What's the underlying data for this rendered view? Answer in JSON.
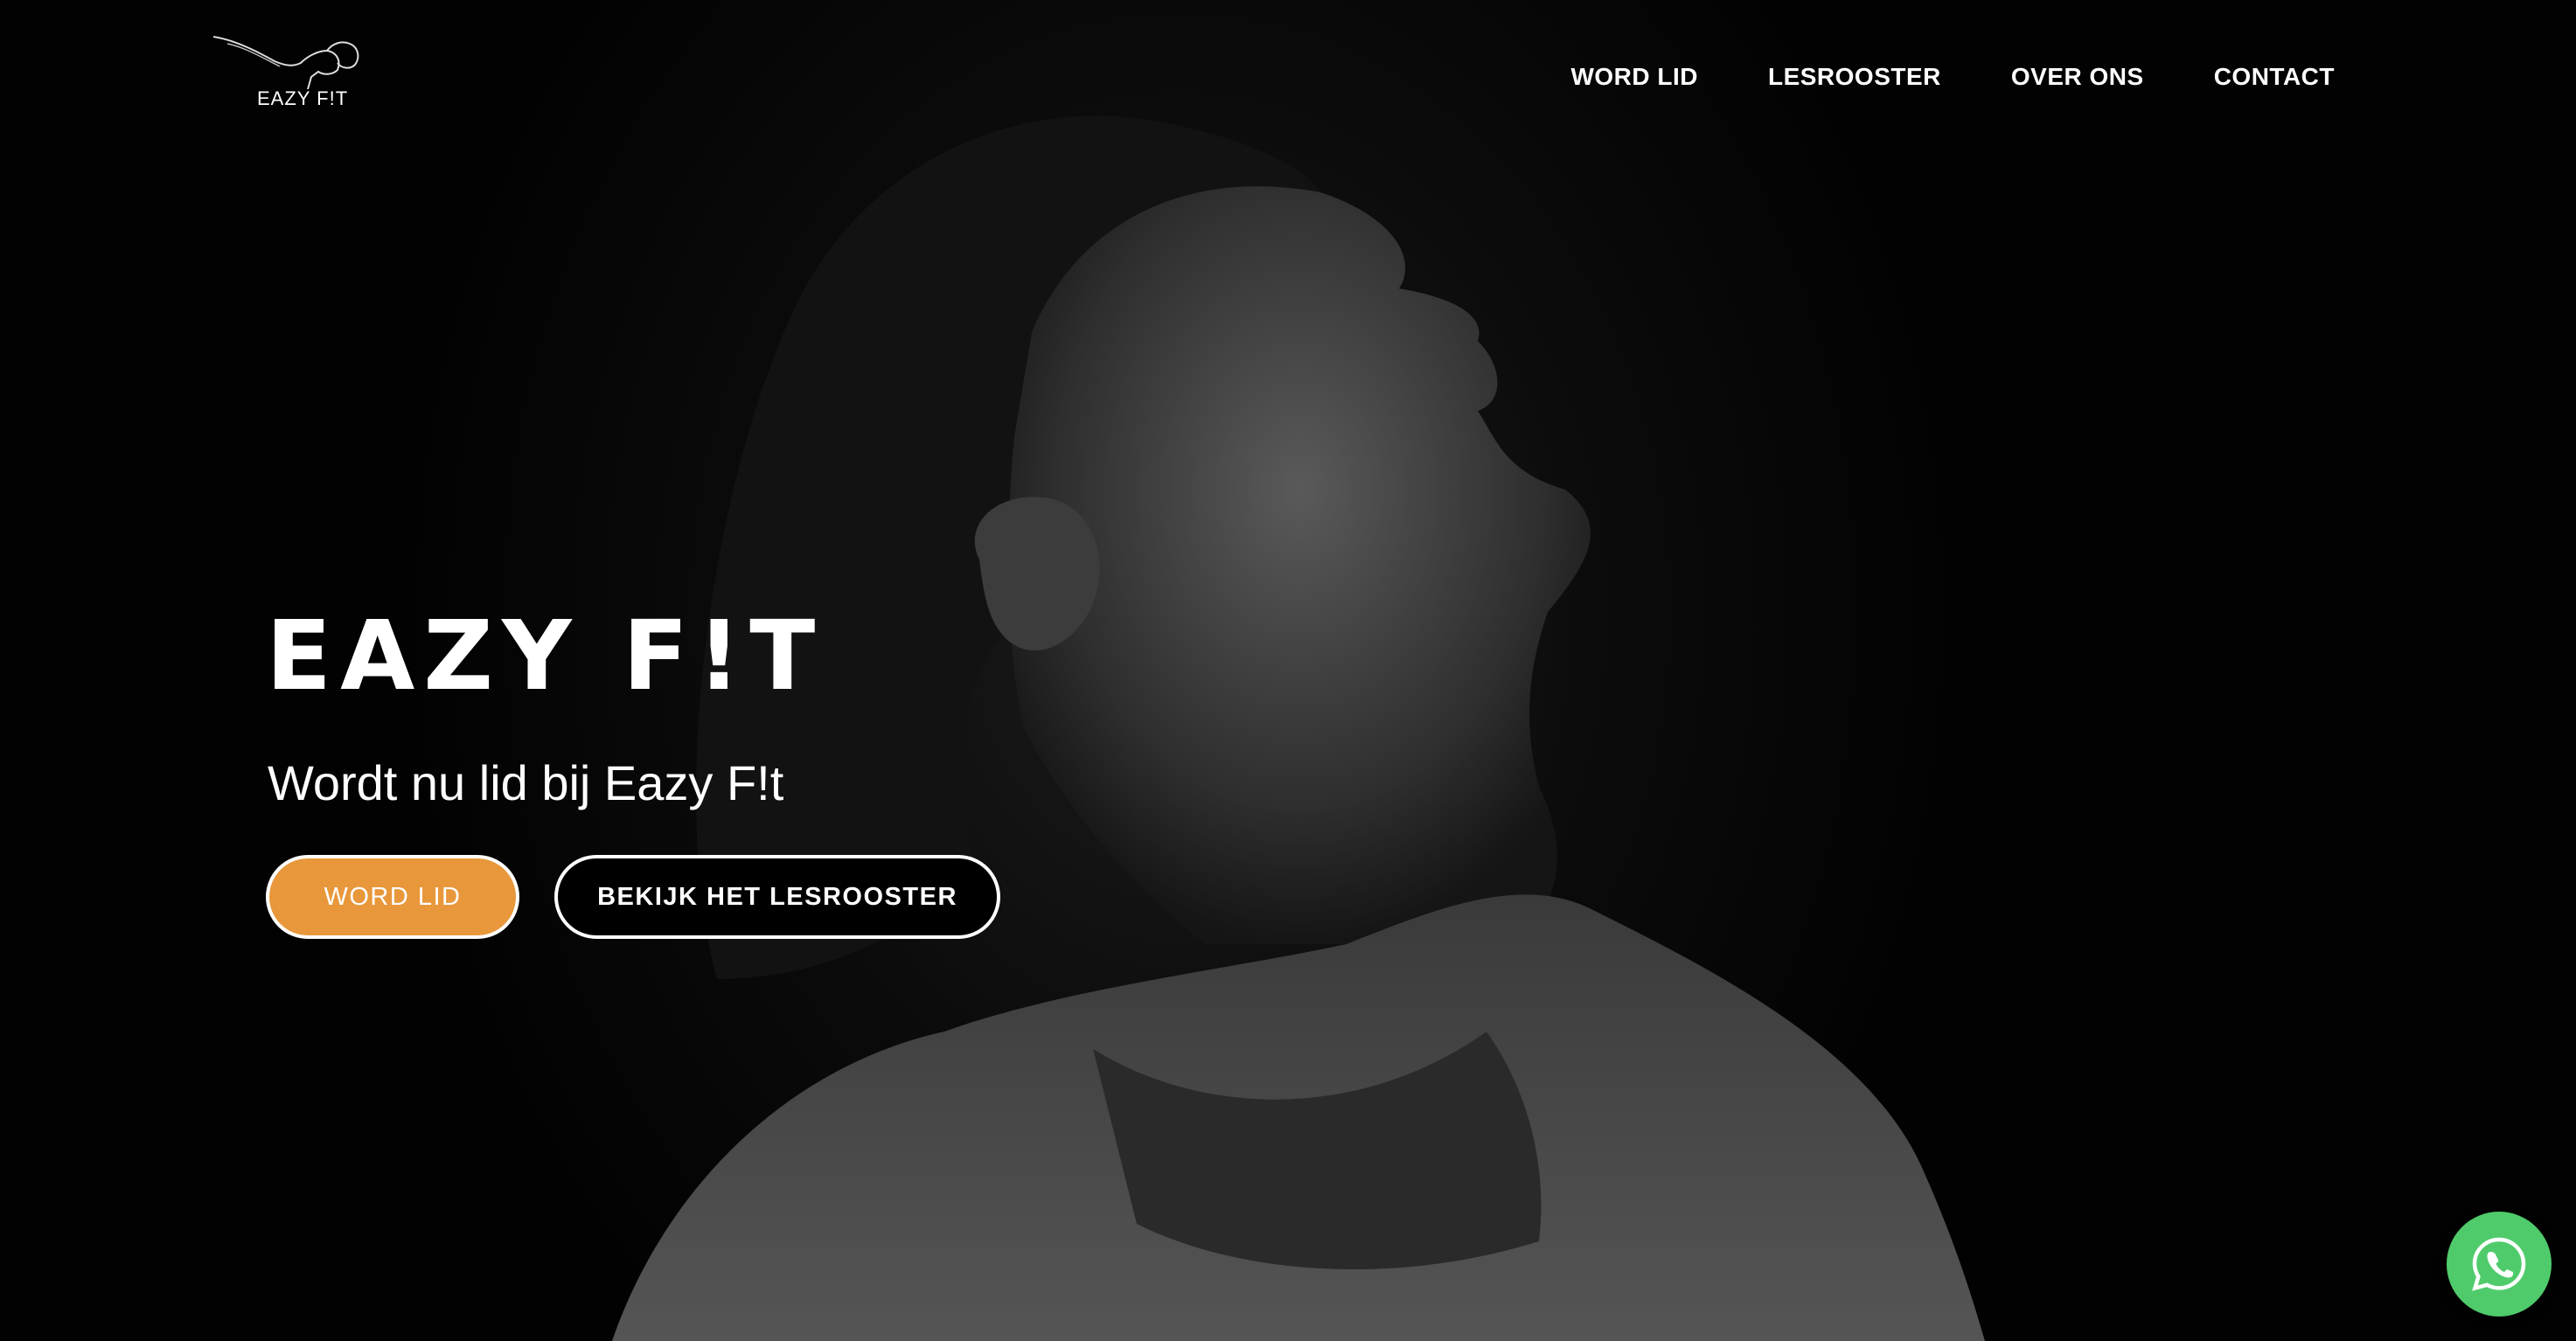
{
  "header": {
    "logo_text": "EAZY F!T",
    "nav": [
      {
        "label": "WORD LID"
      },
      {
        "label": "LESROOSTER"
      },
      {
        "label": "OVER ONS"
      },
      {
        "label": "CONTACT"
      }
    ]
  },
  "hero": {
    "title": "EAZY F!T",
    "subtitle": "Wordt nu lid bij Eazy F!t",
    "primary_button": "WORD LID",
    "secondary_button": "BEKIJK HET LESROOSTER",
    "accent_color": "#e8973b"
  },
  "floating": {
    "whatsapp_icon": "whatsapp-icon",
    "whatsapp_color": "#4fcb6b"
  }
}
